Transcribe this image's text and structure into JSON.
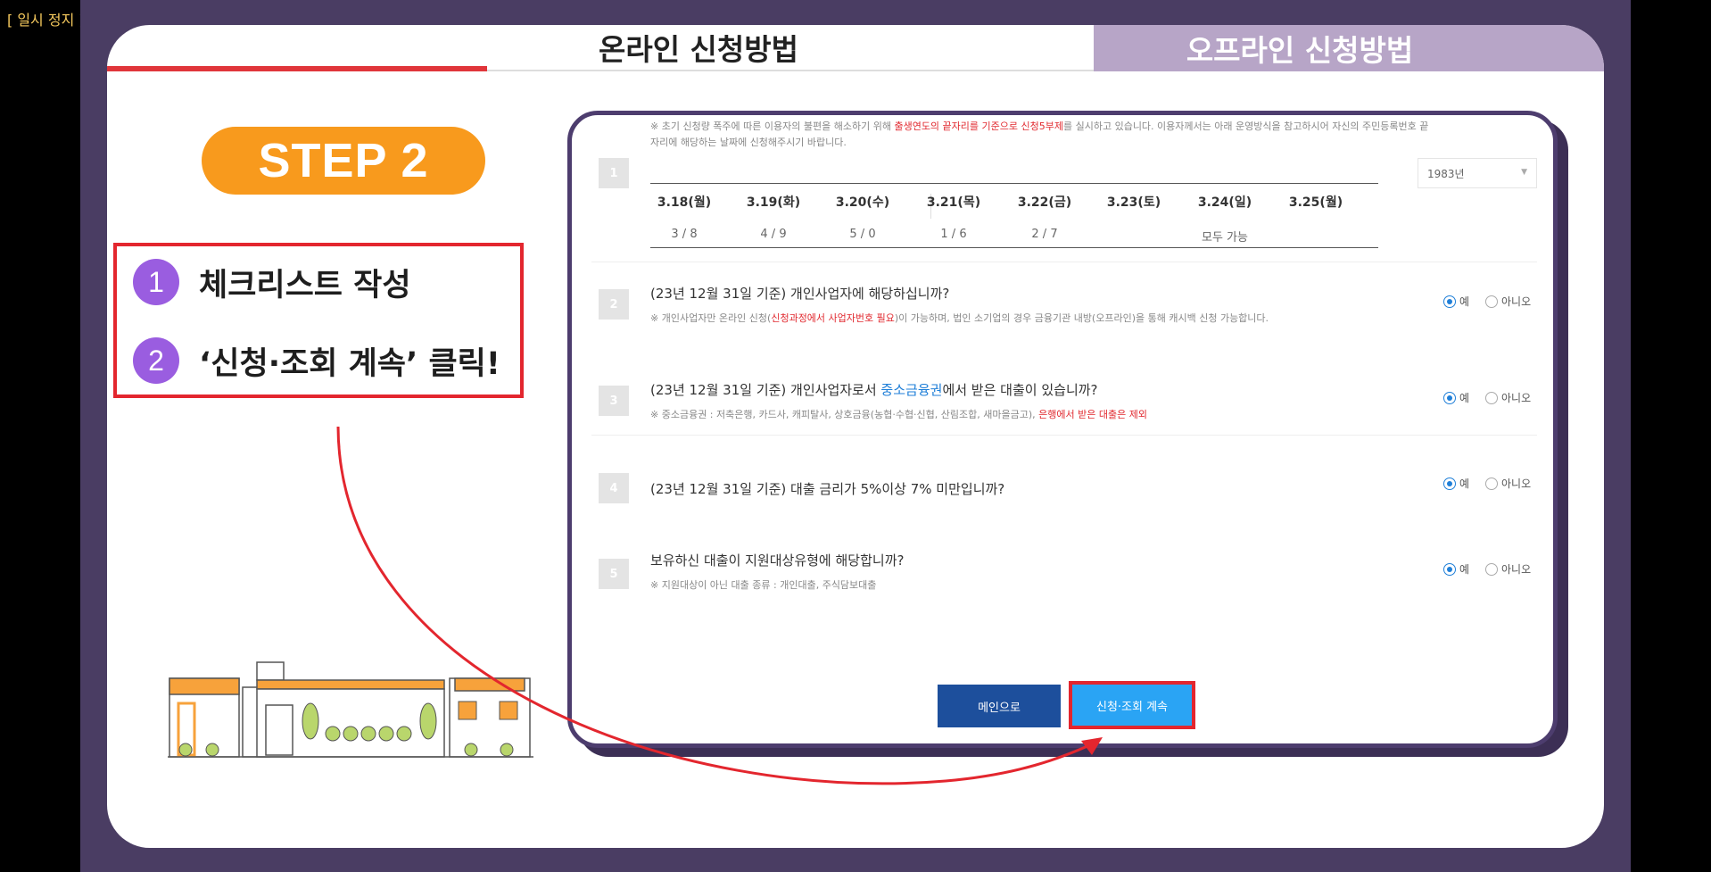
{
  "overlay": {
    "paused_label": "[ 일시 정지 ]"
  },
  "tabs": {
    "online": "온라인 신청방법",
    "offline": "오프라인 신청방법"
  },
  "step": {
    "badge": "STEP 2",
    "items": [
      {
        "num": "1",
        "text": "체크리스트 작성"
      },
      {
        "num": "2",
        "text": "‘신청·조회 계속’ 클릭!"
      }
    ]
  },
  "form": {
    "notice_part1": "※ 초기 신청량 폭주에 따른 이용자의 불편을 해소하기 위해 ",
    "notice_red": "출생연도의 끝자리를 기준으로 신청5부제",
    "notice_part2": "를 실시하고 있습니다. 이용자께서는 아래 운영방식을 참고하시어 자신의 주민등록번호 끝자리에 해당하는 날짜에 신청해주시기 바랍니다.",
    "q1": {
      "num": "1",
      "year_select": "1983년",
      "dates": [
        "3.18(월)",
        "3.19(화)",
        "3.20(수)",
        "3.21(목)",
        "3.22(금)",
        "3.23(토)",
        "3.24(일)",
        "3.25(월)"
      ],
      "digits": [
        "3 / 8",
        "4 / 9",
        "5 / 0",
        "1 / 6",
        "2 / 7",
        "",
        "모두 가능",
        ""
      ]
    },
    "q2": {
      "num": "2",
      "question": "(23년 12월 31일 기준) 개인사업자에 해당하십니까?",
      "note_part1": "※ 개인사업자만 온라인 신청(",
      "note_red": "신청과정에서 사업자번호 필요",
      "note_part2": ")이 가능하며, 법인 소기업의 경우 금융기관 내방(오프라인)을 통해 캐시백 신청 가능합니다."
    },
    "q3": {
      "num": "3",
      "question_part1": "(23년 12월 31일 기준) 개인사업자로서 ",
      "question_blue": "중소금융권",
      "question_part2": "에서 받은 대출이 있습니까?",
      "note_part1": "※ 중소금융권 : 저축은행, 카드사, 캐피탈사, 상호금융(농협·수협·신협, 산림조합, 새마을금고), ",
      "note_red": "은행에서 받은 대출은 제외"
    },
    "q4": {
      "num": "4",
      "question": "(23년 12월 31일 기준) 대출 금리가 5%이상 7% 미만입니까?"
    },
    "q5": {
      "num": "5",
      "question": "보유하신 대출이 지원대상유형에 해당합니까?",
      "note": "※ 지원대상이 아닌 대출 종류 : 개인대출, 주식담보대출"
    },
    "radio_yes": "예",
    "radio_no": "아니오",
    "btn_main": "메인으로",
    "btn_continue": "신청·조회 계속"
  }
}
